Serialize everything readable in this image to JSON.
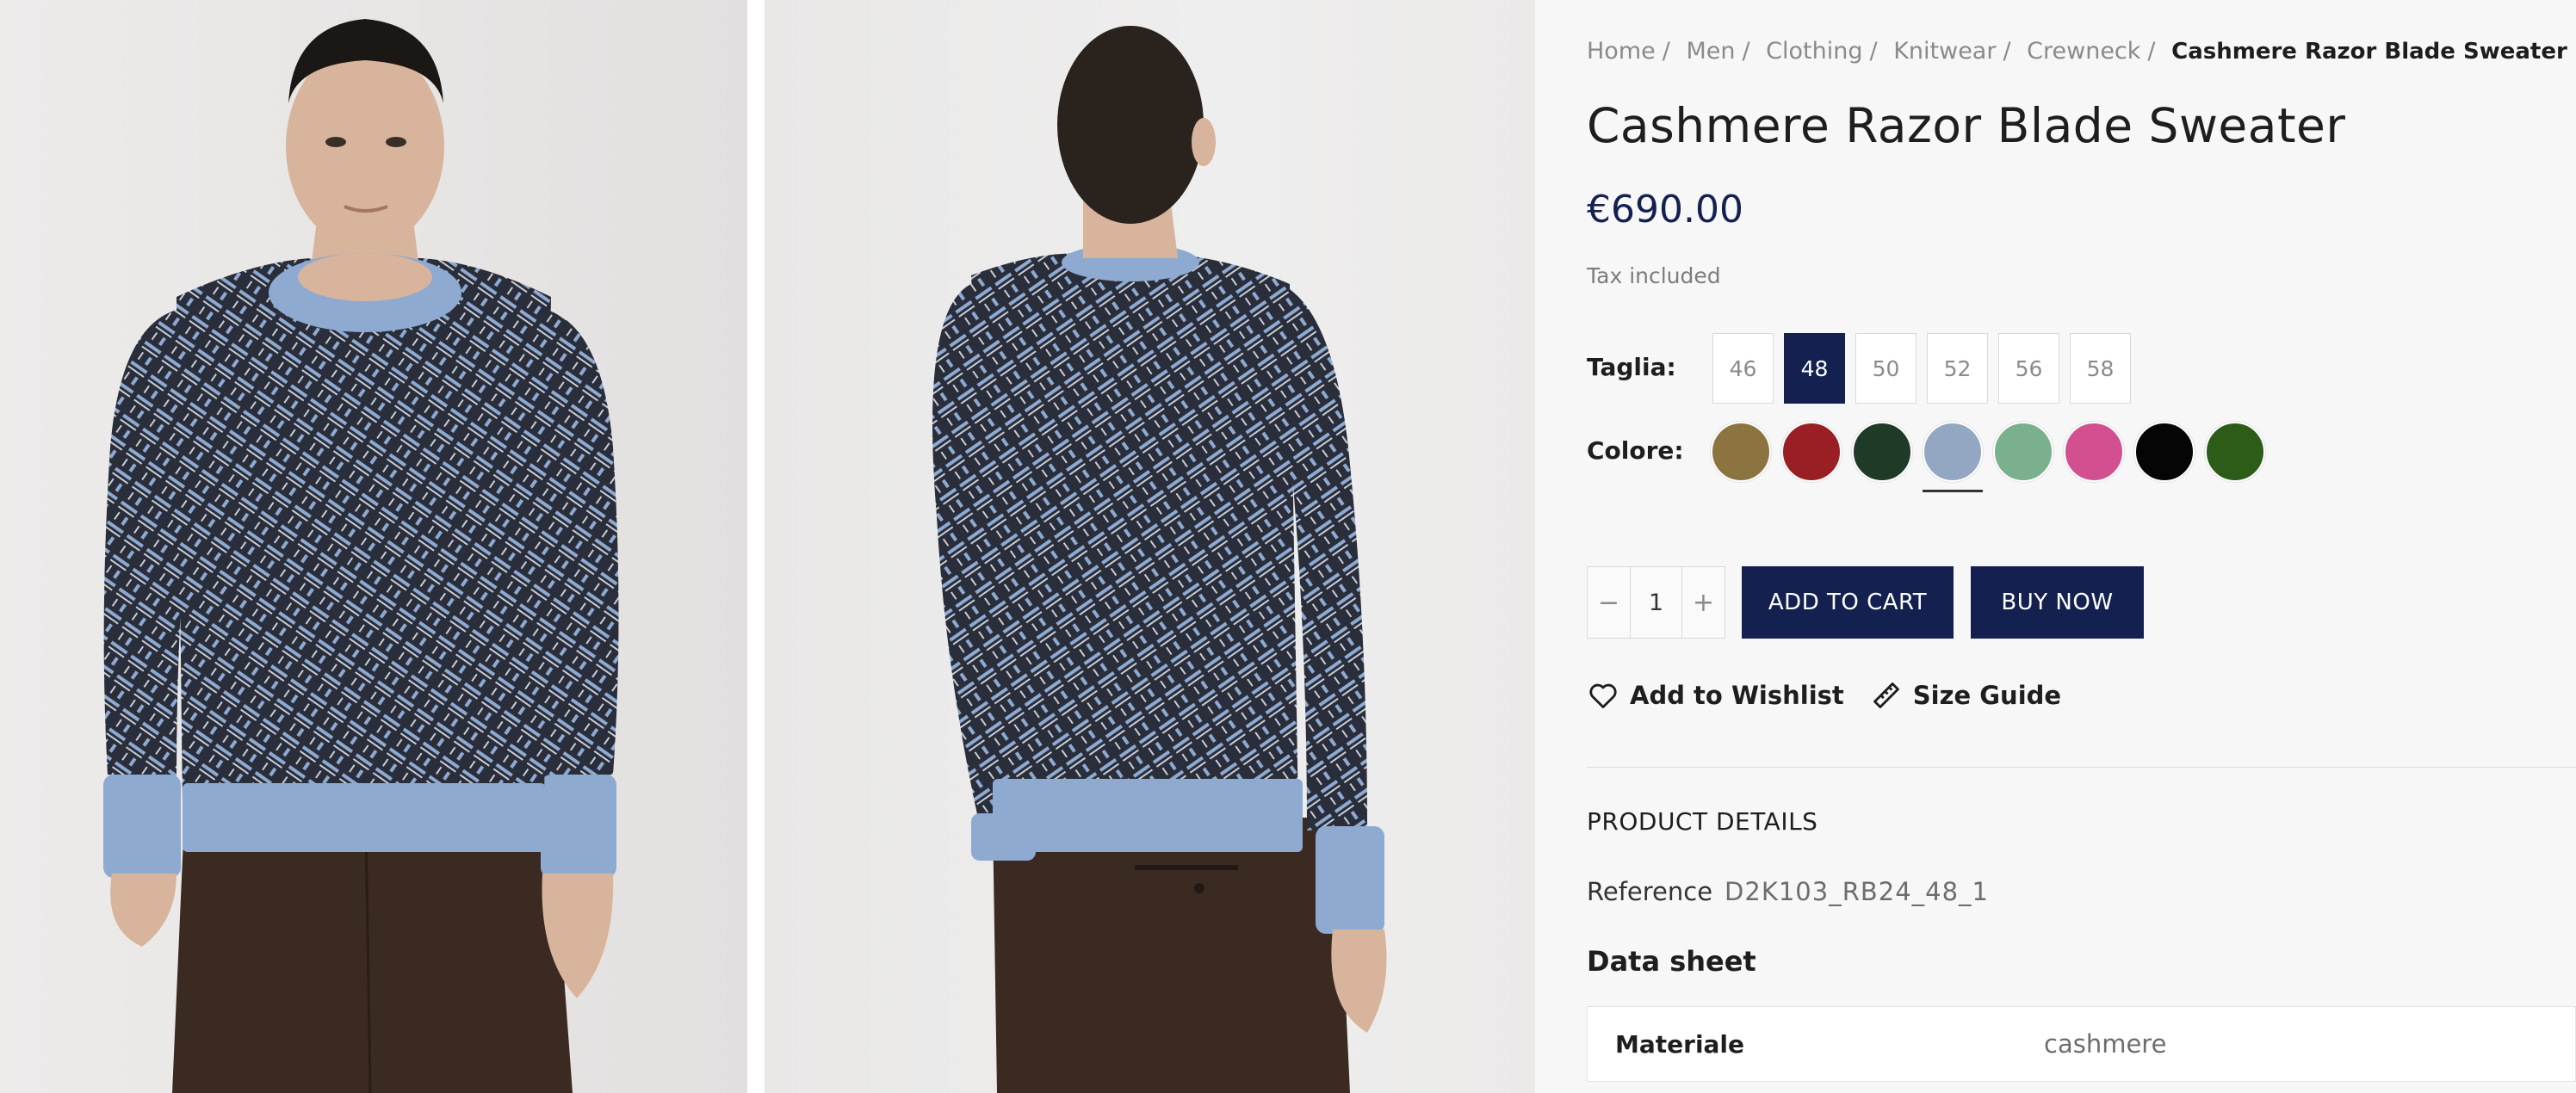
{
  "breadcrumb": {
    "items": [
      "Home",
      "Men",
      "Clothing",
      "Knitwear",
      "Crewneck"
    ],
    "current": "Cashmere Razor Blade Sweater"
  },
  "product": {
    "title": "Cashmere Razor Blade Sweater",
    "price": "€690.00",
    "tax_note": "Tax included"
  },
  "size": {
    "label": "Taglia:",
    "options": [
      "46",
      "48",
      "50",
      "52",
      "56",
      "58"
    ],
    "selected": "48"
  },
  "color": {
    "label": "Colore:",
    "swatches": [
      "#8c7440",
      "#9a1f24",
      "#1f3a26",
      "#93a6c2",
      "#7bb08f",
      "#d2508f",
      "#050505",
      "#2d5c19"
    ],
    "selected_index": 3
  },
  "quantity": {
    "value": "1",
    "minus": "−",
    "plus": "+"
  },
  "actions": {
    "add_to_cart": "ADD TO CART",
    "buy_now": "BUY NOW",
    "wishlist": "Add to Wishlist",
    "size_guide": "Size Guide"
  },
  "details": {
    "section_title": "PRODUCT DETAILS",
    "reference_label": "Reference",
    "reference_value": "D2K103_RB24_48_1",
    "datasheet_title": "Data sheet",
    "datasheet": [
      {
        "key": "Materiale",
        "value": "cashmere"
      }
    ]
  },
  "colors": {
    "primary": "#14204f",
    "sweater_body": "#2d3140",
    "sweater_trim": "#8eaad1",
    "trousers": "#3a2a22",
    "skin": "#d8b49c"
  },
  "icons": {
    "wishlist": "heart-icon",
    "size_guide": "ruler-icon"
  }
}
